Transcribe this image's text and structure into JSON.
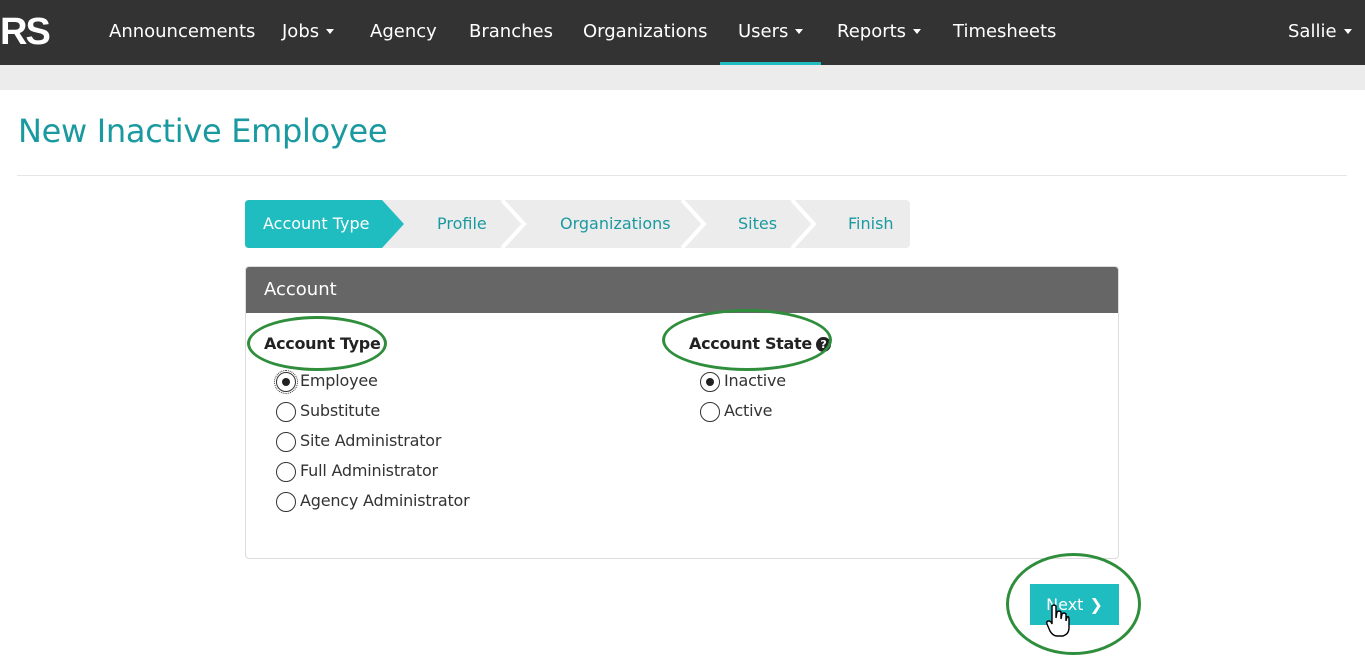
{
  "nav": {
    "brand": "RS",
    "items": [
      {
        "label": "Announcements",
        "dropdown": false
      },
      {
        "label": "Jobs",
        "dropdown": true
      },
      {
        "label": "Agency",
        "dropdown": false
      },
      {
        "label": "Branches",
        "dropdown": false
      },
      {
        "label": "Organizations",
        "dropdown": false
      },
      {
        "label": "Users",
        "dropdown": true,
        "active": true
      },
      {
        "label": "Reports",
        "dropdown": true
      },
      {
        "label": "Timesheets",
        "dropdown": false
      }
    ],
    "user": {
      "label": "Sallie",
      "dropdown": true
    }
  },
  "page": {
    "title": "New Inactive Employee"
  },
  "wizard": {
    "steps": [
      {
        "label": "Account Type",
        "active": true
      },
      {
        "label": "Profile",
        "active": false
      },
      {
        "label": "Organizations",
        "active": false
      },
      {
        "label": "Sites",
        "active": false
      },
      {
        "label": "Finish",
        "active": false
      }
    ]
  },
  "panel": {
    "heading": "Account",
    "account_type": {
      "label": "Account Type",
      "options": [
        "Employee",
        "Substitute",
        "Site Administrator",
        "Full Administrator",
        "Agency Administrator"
      ],
      "selected": "Employee"
    },
    "account_state": {
      "label": "Account State",
      "help_icon": "question-circle-icon",
      "options": [
        "Inactive",
        "Active"
      ],
      "selected": "Inactive"
    }
  },
  "next_button": {
    "label": "Next",
    "icon": "chevron-right-icon"
  },
  "colors": {
    "accent": "#1fbcc0",
    "title": "#1a9aa0",
    "navbar": "#333333",
    "panel_heading": "#666666",
    "highlight": "#2f8e3c"
  }
}
